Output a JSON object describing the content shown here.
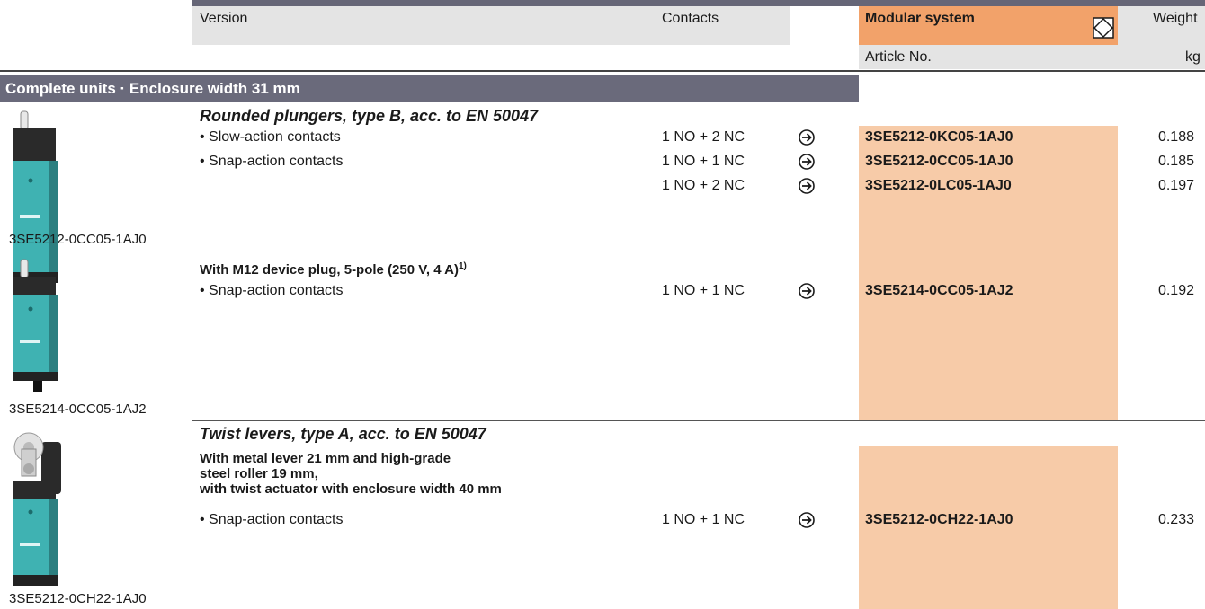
{
  "header": {
    "version": "Version",
    "contacts": "Contacts",
    "modular_system": "Modular system",
    "modular_icon": "diamond-in-box-icon",
    "weight": "Weight",
    "article_no": "Article No.",
    "unit": "kg"
  },
  "banner": "Complete units · Enclosure width 31 mm",
  "section1": {
    "title": "Rounded plungers, type B, acc. to EN 50047",
    "rows": [
      {
        "label": "• Slow-action contacts",
        "contacts": "1 NO + 2 NC",
        "article": "3SE5212-0KC05-1AJ0",
        "weight": "0.188"
      },
      {
        "label": "• Snap-action contacts",
        "contacts": "1 NO + 1 NC",
        "article": "3SE5212-0CC05-1AJ0",
        "weight": "0.185"
      },
      {
        "label": "",
        "contacts": "1 NO + 2 NC",
        "article": "3SE5212-0LC05-1AJ0",
        "weight": "0.197"
      }
    ],
    "image_caption": "3SE5212-0CC05-1AJ0"
  },
  "section2": {
    "subtitle": "With M12 device plug, 5-pole (250 V, 4 A)",
    "footnote": "1)",
    "rows": [
      {
        "label": "• Snap-action contacts",
        "contacts": "1 NO + 1 NC",
        "article": "3SE5214-0CC05-1AJ2",
        "weight": "0.192"
      }
    ],
    "image_caption": "3SE5214-0CC05-1AJ2"
  },
  "section3": {
    "title": "Twist levers, type A, acc. to EN 50047",
    "subtitle_lines": [
      "With metal lever 21 mm and high-grade",
      "steel roller 19 mm,",
      "with twist actuator with enclosure width 40 mm"
    ],
    "rows": [
      {
        "label": "• Snap-action contacts",
        "contacts": "1 NO + 1 NC",
        "article": "3SE5212-0CH22-1AJ0",
        "weight": "0.233"
      }
    ],
    "image_caption": "3SE5212-0CH22-1AJ0"
  },
  "colors": {
    "banner": "#6a6a7b",
    "header_grey": "#e4e4e4",
    "modular_orange": "#f2a26a",
    "article_peach": "#f7cba8",
    "switch_body": "#3fb2b2"
  },
  "icons": {
    "availability_arrow": "circled-arrow-right-icon"
  }
}
